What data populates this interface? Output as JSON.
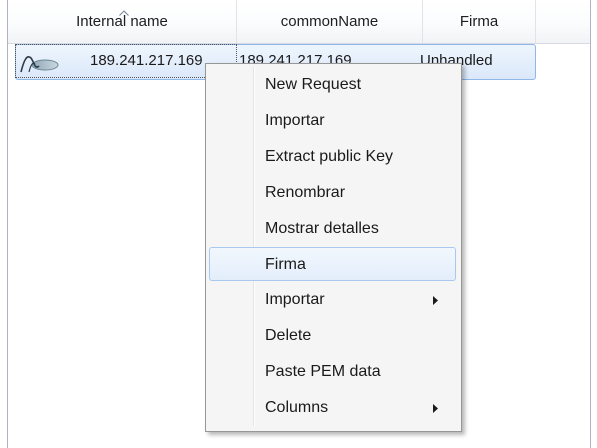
{
  "columns": [
    "Internal name",
    "commonName",
    "Firma"
  ],
  "row": {
    "internal_name": "189.241.217.169",
    "common_name": "189.241.217.169",
    "firma": "Unhandled",
    "icon": "certificate-request-icon"
  },
  "menu": {
    "items": [
      {
        "label": "New Request"
      },
      {
        "label": "Importar"
      },
      {
        "label": "Extract public Key"
      },
      {
        "label": "Renombrar"
      },
      {
        "label": "Mostrar detalles"
      },
      {
        "label": "Firma",
        "highlighted": true
      },
      {
        "label": "Importar",
        "submenu": true
      },
      {
        "label": "Delete"
      },
      {
        "label": "Paste PEM data"
      },
      {
        "label": "Columns",
        "submenu": true
      }
    ]
  },
  "colors": {
    "selection": "#dbe8fa",
    "selection_border": "#8fb7e8",
    "menu_background": "#f5f5f5",
    "menu_highlight": "#e3eefb"
  }
}
